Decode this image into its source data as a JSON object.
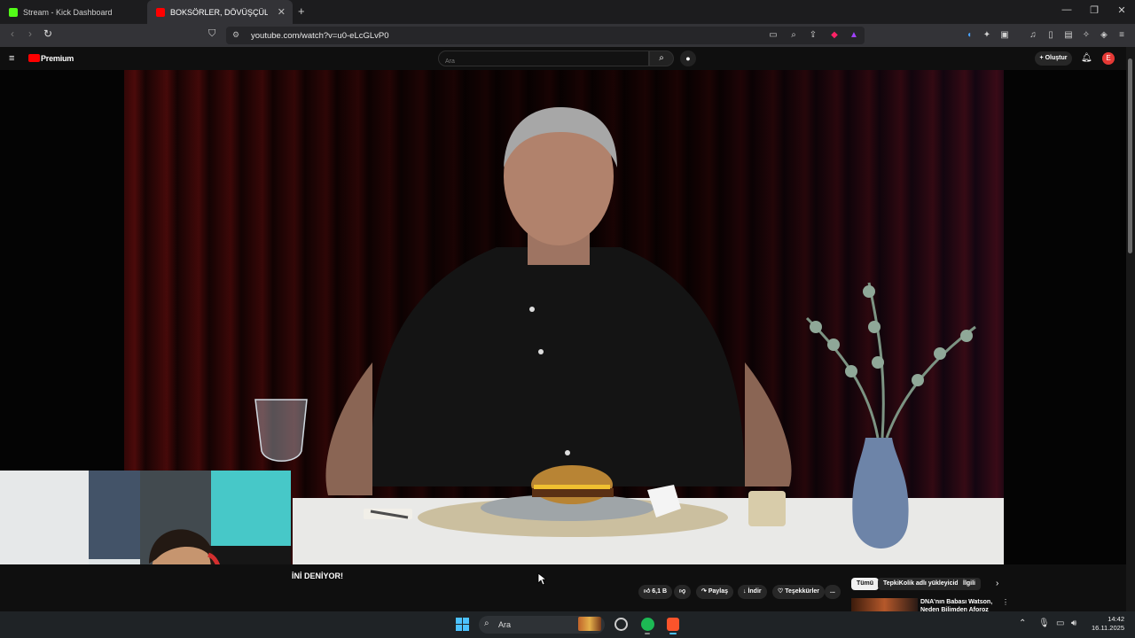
{
  "browser": {
    "tabs": [
      {
        "label": "Stream - Kick Dashboard",
        "favicon_color": "#53fc18"
      },
      {
        "label": "BOKSÖRLER, DÖVÜŞÇÜLERİN...",
        "favicon_color": "#ff0000"
      }
    ],
    "url": "youtube.com/watch?v=u0-eLcGLvP0",
    "window_controls": [
      "minimize",
      "restore",
      "close"
    ]
  },
  "youtube": {
    "brand": "Premium",
    "search_placeholder": "Ara",
    "create_label": "Oluştur",
    "avatar_letter": "E"
  },
  "video": {
    "title_fragment": "İNİ DENİYOR!",
    "actions": {
      "likes": "6,1 B",
      "share": "Paylaş",
      "download": "İndir",
      "thanks": "Teşekkürler",
      "more": "..."
    }
  },
  "chips": [
    "Tümü",
    "TepkiKolik adlı yükleyiciden",
    "İlgili"
  ],
  "recommendation": {
    "title": "DNA'nın Babası Watson, Neden Bilimden Aforoz Edildi?"
  },
  "taskbar": {
    "search_label": "Ara",
    "time": "14:42",
    "date": "16.11.2025"
  },
  "colors": {
    "youtube_red": "#ff0000",
    "kick_green": "#53fc18",
    "spotify_green": "#1db954"
  }
}
